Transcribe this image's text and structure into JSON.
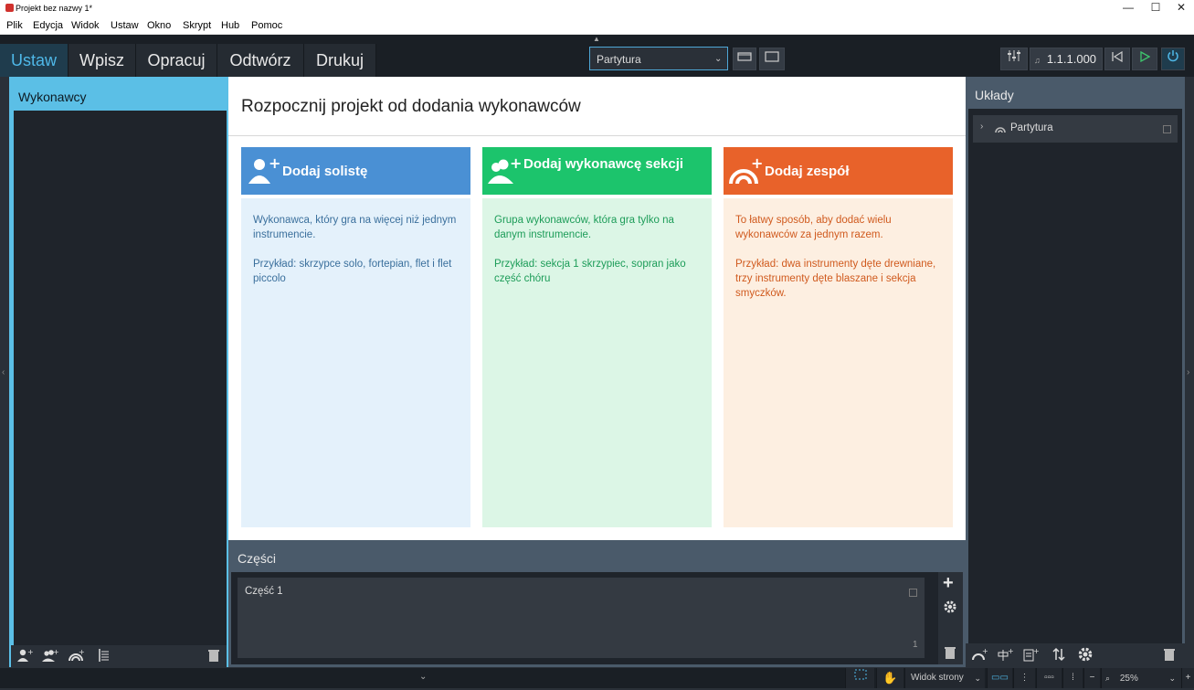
{
  "window": {
    "title": "Projekt bez nazwy 1*",
    "minimize": "—",
    "maximize": "☐",
    "close": "✕"
  },
  "menu": [
    "Plik",
    "Edycja",
    "Widok",
    "Ustaw",
    "Okno",
    "Skrypt",
    "Hub",
    "Pomoc"
  ],
  "modes": [
    "Ustaw",
    "Wpisz",
    "Opracuj",
    "Odtwórz",
    "Drukuj"
  ],
  "active_mode": "Ustaw",
  "layout_select": {
    "value": "Partytura"
  },
  "transport": {
    "position": "1.1.1.000"
  },
  "players_panel": {
    "title": "Wykonawcy"
  },
  "center": {
    "title": "Rozpocznij projekt od dodania wykonawców",
    "cards": [
      {
        "title": "Dodaj solistę",
        "desc": "Wykonawca, który gra na więcej niż jednym instrumencie.",
        "example": "Przykład: skrzypce solo, fortepian, flet i flet piccolo",
        "head_color": "#4a90d4",
        "body_color": "#e4f1fb",
        "text_color": "#3a6f9c"
      },
      {
        "title": "Dodaj wykonawcę sekcji",
        "desc": "Grupa wykonawców, która gra tylko na danym instrumencie.",
        "example": "Przykład: sekcja 1 skrzypiec, sopran jako część chóru",
        "head_color": "#1cc46c",
        "body_color": "#dcf6e6",
        "text_color": "#1c9c58"
      },
      {
        "title": "Dodaj zespół",
        "desc": "To łatwy sposób, aby dodać wielu wykonawców za jednym razem.",
        "example": "Przykład: dwa instrumenty dęte drewniane, trzy instrumenty dęte blaszane i sekcja smyczków.",
        "head_color": "#e8622a",
        "body_color": "#fdefe1",
        "text_color": "#d05a1e"
      }
    ]
  },
  "parts_panel": {
    "title": "Części",
    "item": "Część 1",
    "count": "1"
  },
  "layouts_panel": {
    "title": "Układy",
    "item": "Partytura"
  },
  "status": {
    "view": "Widok strony",
    "zoom": "25%"
  },
  "colors": {
    "accent": "#4fb8e8",
    "panel_dark": "#1f242b"
  }
}
